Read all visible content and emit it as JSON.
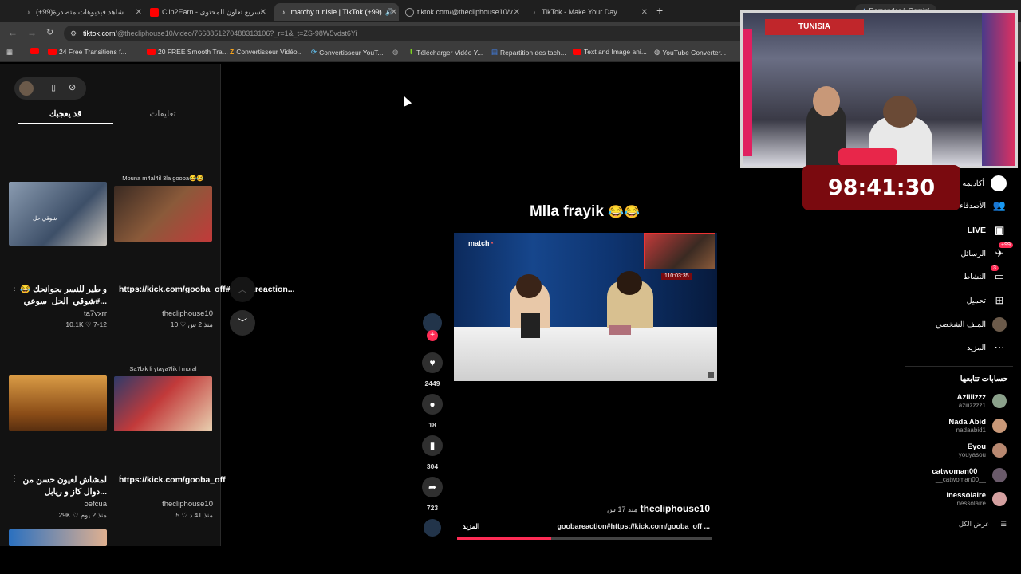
{
  "tabs": [
    {
      "title": "(+99)شاهد فيديوهات متصدرة",
      "icon": "tiktok-icon"
    },
    {
      "title": "Clip2Earn - تسريع تعاون المحتوى",
      "icon": "youtube-icon"
    },
    {
      "title": "matchy tunisie | TikTok (+99)",
      "icon": "tiktok-icon"
    },
    {
      "title": "tiktok.com/@thecliphouse10/v",
      "icon": "globe-icon"
    },
    {
      "title": "TikTok - Make Your Day",
      "icon": "tiktok-icon"
    }
  ],
  "gemini_button": "Demander à Gemini",
  "url": {
    "domain": "tiktok.com",
    "path": "/@thecliphouse10/video/7668851270488313106?_r=1&_t=ZS-98W5vdst6Yi"
  },
  "bookmarks": [
    "24 Free Transitions f...",
    "20 FREE Smooth Tra...",
    "Convertisseur Vidéo...",
    "Convertisseur YouT...",
    "Télécharger Vidéo Y...",
    "Repartition des tach...",
    "Text and Image ani...",
    "YouTube Converter..."
  ],
  "left_panel": {
    "tabs": [
      "قد يعجبك",
      "تعليقات"
    ],
    "cards": [
      {
        "caption": "",
        "title": "و طير للنسر بجوانحك 😂 #شوقي_الحل_سوعي...",
        "author": "ta7vxrr",
        "likes": "10.1K",
        "date": "7-12"
      },
      {
        "caption": "Mouna m4al4il 3la gooba😂😂",
        "title": "https://kick.com/gooba_off#goobareaction...",
        "author": "thecliphouse10",
        "likes": "10",
        "date": "منذ 2 س"
      },
      {
        "caption": "",
        "title": "لمشاش لعيون حسن من دوال كاز و ريابل...",
        "author": "oefcua",
        "likes": "29K",
        "date": "منذ 2 يوم"
      },
      {
        "caption": "Sa7bik li ytaya7lik l moral",
        "title": "https://kick.com/gooba_off",
        "author": "thecliphouse10",
        "likes": "5",
        "date": "منذ 41 د"
      }
    ]
  },
  "video": {
    "title": "Mlla frayik",
    "emoji": "😂😂",
    "brand": "match",
    "inset_timer": "110:03:35",
    "author": "thecliphouse10",
    "time_ago": "منذ 17 س",
    "caption": "goobareaction#https://kick.com/gooba_off ...",
    "more": "المزيد",
    "progress": 0.37
  },
  "actions": {
    "likes": "2449",
    "comments": "18",
    "saves": "304",
    "shares": "723"
  },
  "nav": [
    {
      "label": "أكاديمه",
      "icon": "academy-icon"
    },
    {
      "label": "الأصدقاء",
      "icon": "friends-icon"
    },
    {
      "label": "LIVE",
      "icon": "live-icon"
    },
    {
      "label": "الرسائل",
      "icon": "messages-icon",
      "badge": "+99"
    },
    {
      "label": "النشاط",
      "icon": "activity-icon",
      "badge": "3"
    },
    {
      "label": "تحميل",
      "icon": "upload-icon"
    },
    {
      "label": "الملف الشخصي",
      "icon": "profile-icon"
    },
    {
      "label": "المزيد",
      "icon": "more-icon"
    }
  ],
  "following": {
    "heading": "حسابات تتابعها",
    "accounts": [
      {
        "name": "Aziiiizzz",
        "handle": "aziiizzzz1"
      },
      {
        "name": "Nada Abid",
        "handle": "nadaabid1"
      },
      {
        "name": "Eyou",
        "handle": "youyasou"
      },
      {
        "name": "__catwoman00__",
        "handle": "__catwoman00__"
      },
      {
        "name": "inessolaire",
        "handle": "inessolaire"
      }
    ],
    "see_all": "عرض الكل"
  },
  "webcam": {
    "banner": "TUNISIA",
    "timer": "98:41:30"
  },
  "colors": {
    "accent": "#fe2c55",
    "timer_bg": "#7a0a0f"
  }
}
